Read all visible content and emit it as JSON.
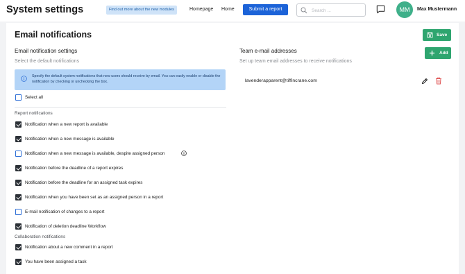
{
  "header": {
    "title": "System settings",
    "info_link": "Find out more about the new modules",
    "nav": [
      "Homepage",
      "Home"
    ],
    "submit_label": "Submit a report",
    "search_placeholder": "Search ...",
    "user_initials": "MM",
    "user_name": "Max Mustermann"
  },
  "page": {
    "title": "Email notifications",
    "save_label": "Save",
    "add_label": "Add"
  },
  "left": {
    "heading": "Email notification settings",
    "subheading": "Select the default notifications",
    "info_text": "Specify the default system notifications that new users should receive by email. You can easily enable or disable the notification by checking or unchecking the box.",
    "select_all": {
      "label": "Select all",
      "checked": false
    },
    "groups": [
      {
        "title": "Report notifications",
        "items": [
          {
            "label": "Notification when a new report is available",
            "checked": true
          },
          {
            "label": "Notification when a new message is available",
            "checked": true
          },
          {
            "label": "Notification when a new message is available, despite assigned person",
            "checked": false,
            "has_info": true
          },
          {
            "label": "Notification before the deadline of a report expires",
            "checked": true
          },
          {
            "label": "Notification before the deadline for an assigned task expires",
            "checked": true
          },
          {
            "label": "Notification when you have been set as an assigned person in a report",
            "checked": true
          },
          {
            "label": "E-mail notification of changes to a report",
            "checked": false
          },
          {
            "label": "Notification of deletion deadline Workflow",
            "checked": true
          }
        ]
      },
      {
        "title": "Collaboration notifications",
        "items": [
          {
            "label": "Notification about a new comment in a report",
            "checked": true
          },
          {
            "label": "You have been assigned a task",
            "checked": true
          }
        ]
      }
    ]
  },
  "right": {
    "heading": "Team e-mail addresses",
    "subheading": "Set up team email addresses to receive notifications",
    "emails": [
      "lavenderapparent@tiffincrane.com"
    ]
  },
  "colors": {
    "primary": "#1c63d8",
    "success": "#2ea56f",
    "danger": "#e05555",
    "avatar": "#3fb08a",
    "info_bg": "#b3d4f7"
  }
}
